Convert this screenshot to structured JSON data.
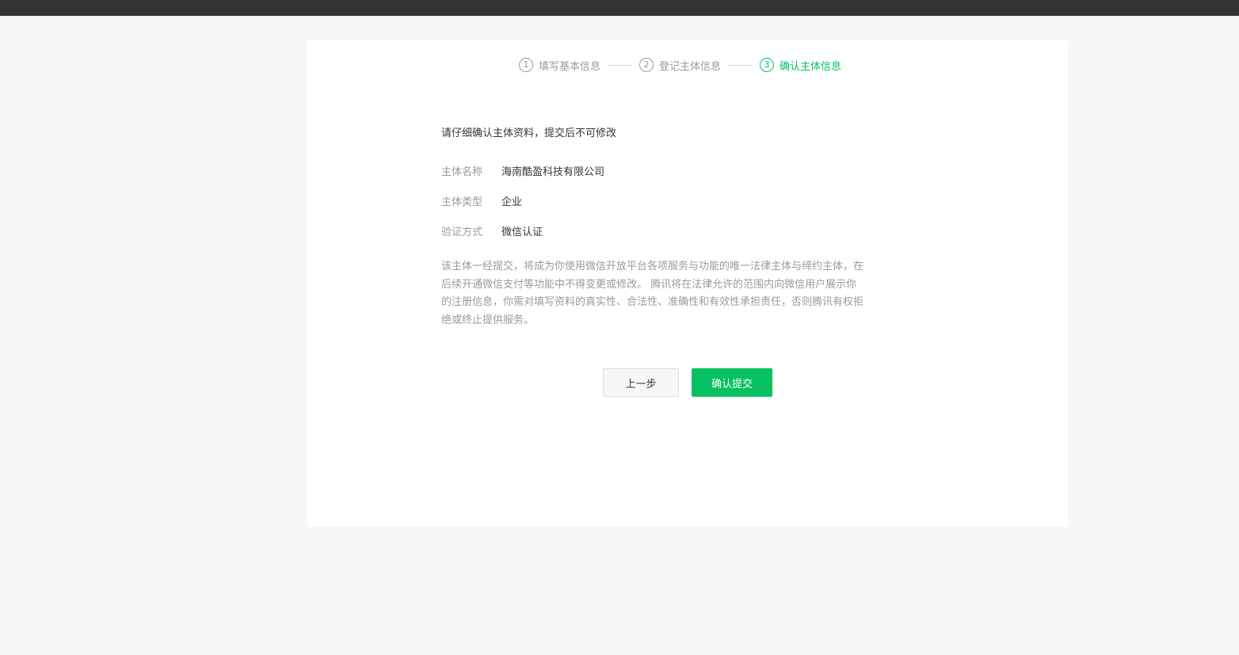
{
  "steps": [
    {
      "number": "1",
      "label": "填写基本信息",
      "state": "done"
    },
    {
      "number": "2",
      "label": "登记主体信息",
      "state": "done"
    },
    {
      "number": "3",
      "label": "确认主体信息",
      "state": "active"
    }
  ],
  "notice": "请仔细确认主体资料，提交后不可修改",
  "info": [
    {
      "label": "主体名称",
      "value": "海南酷盈科技有限公司"
    },
    {
      "label": "主体类型",
      "value": "企业"
    },
    {
      "label": "验证方式",
      "value": "微信认证"
    }
  ],
  "description": "该主体一经提交，将成为你使用微信开放平台各项服务与功能的唯一法律主体与缔约主体，在后续开通微信支付等功能中不得变更或修改。 腾讯将在法律允许的范围内向微信用户展示你的注册信息，你需对填写资料的真实性、合法性、准确性和有效性承担责任，否则腾讯有权拒绝或终止提供服务。",
  "buttons": {
    "prev_label": "上一步",
    "submit_label": "确认提交"
  },
  "colors": {
    "accent": "#07c160",
    "topbar": "#333333",
    "background": "#f7f7f7"
  }
}
